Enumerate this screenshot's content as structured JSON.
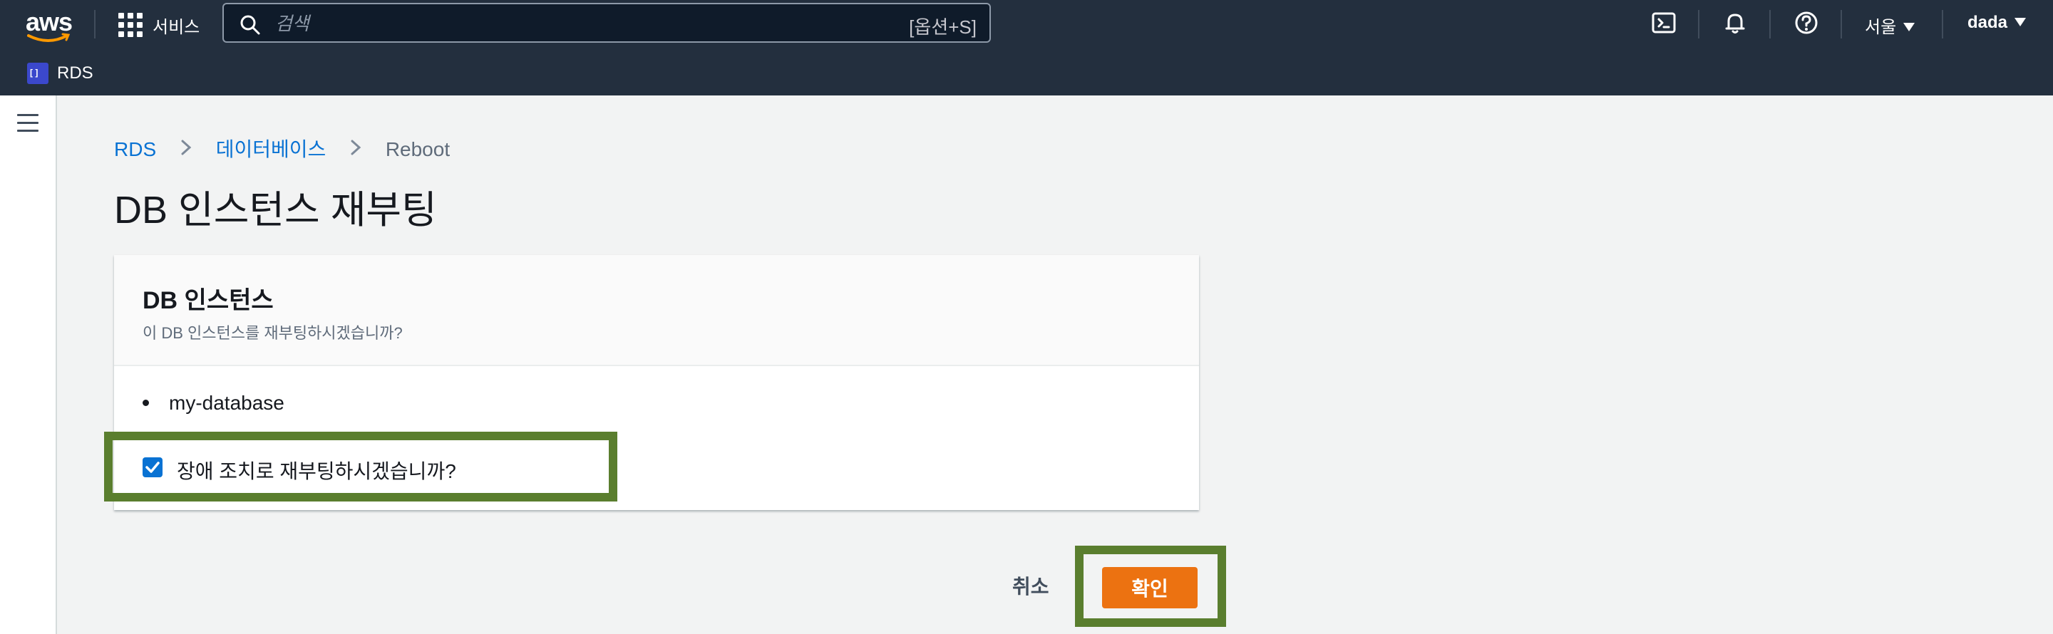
{
  "topnav": {
    "logo": "aws",
    "services_label": "서비스",
    "search": {
      "placeholder": "검색",
      "shortcut": "[옵션+S]"
    },
    "icons": [
      "cloudshell-icon",
      "bell-icon",
      "help-icon"
    ],
    "region": "서울",
    "user": "dada"
  },
  "service_bar": {
    "label": "RDS"
  },
  "breadcrumb": [
    {
      "label": "RDS"
    },
    {
      "label": "데이터베이스"
    },
    {
      "label": "Reboot"
    }
  ],
  "page": {
    "title": "DB 인스턴스 재부팅"
  },
  "card": {
    "title": "DB 인스턴스",
    "description": "이 DB 인스턴스를 재부팅하시겠습니까?",
    "instances": [
      "my-database"
    ],
    "failover_checkbox": {
      "label": "장애 조치로 재부팅하시겠습니까?",
      "checked": true
    }
  },
  "actions": {
    "cancel": "취소",
    "confirm": "확인"
  },
  "colors": {
    "nav_bg": "#232f3e",
    "link": "#0972d3",
    "primary_button": "#ec7211",
    "highlight": "#5a7e2e"
  }
}
